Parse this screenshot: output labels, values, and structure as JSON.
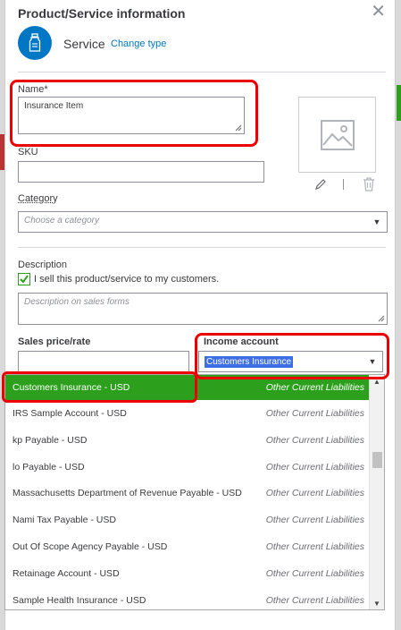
{
  "panel": {
    "title": "Product/Service information",
    "type_label": "Service",
    "change_type": "Change type"
  },
  "name": {
    "label": "Name*",
    "value": "Insurance Item"
  },
  "sku": {
    "label": "SKU",
    "value": ""
  },
  "category": {
    "label": "Category",
    "placeholder": "Choose a category"
  },
  "description": {
    "label": "Description",
    "checkbox_label": "I sell this product/service to my customers.",
    "checked": true,
    "placeholder": "Description on sales forms"
  },
  "sales_price": {
    "label": "Sales price/rate",
    "value": ""
  },
  "income_account": {
    "label": "Income account",
    "value": "Customers Insurance"
  },
  "dropdown": {
    "items": [
      {
        "name": "Customers Insurance - USD",
        "type": "Other Current Liabilities",
        "selected": true
      },
      {
        "name": "IRS Sample Account - USD",
        "type": "Other Current Liabilities"
      },
      {
        "name": "kp Payable - USD",
        "type": "Other Current Liabilities"
      },
      {
        "name": "lo Payable - USD",
        "type": "Other Current Liabilities"
      },
      {
        "name": "Massachusetts Department of Revenue Payable - USD",
        "type": "Other Current Liabilities"
      },
      {
        "name": "Nami Tax Payable - USD",
        "type": "Other Current Liabilities"
      },
      {
        "name": "Out Of Scope Agency Payable - USD",
        "type": "Other Current Liabilities"
      },
      {
        "name": "Retainage Account - USD",
        "type": "Other Current Liabilities"
      },
      {
        "name": "Sample Health Insurance - USD",
        "type": "Other Current Liabilities"
      }
    ]
  },
  "icons": {
    "close": "close-icon",
    "service": "service-bottle-icon",
    "image_placeholder": "image-placeholder-icon",
    "edit": "pencil-icon",
    "delete": "trash-icon"
  },
  "colors": {
    "accent_blue": "#0077c5",
    "green": "#2ca01c",
    "annotation_red": "#e00000",
    "selection_blue": "#3d6ee6"
  }
}
